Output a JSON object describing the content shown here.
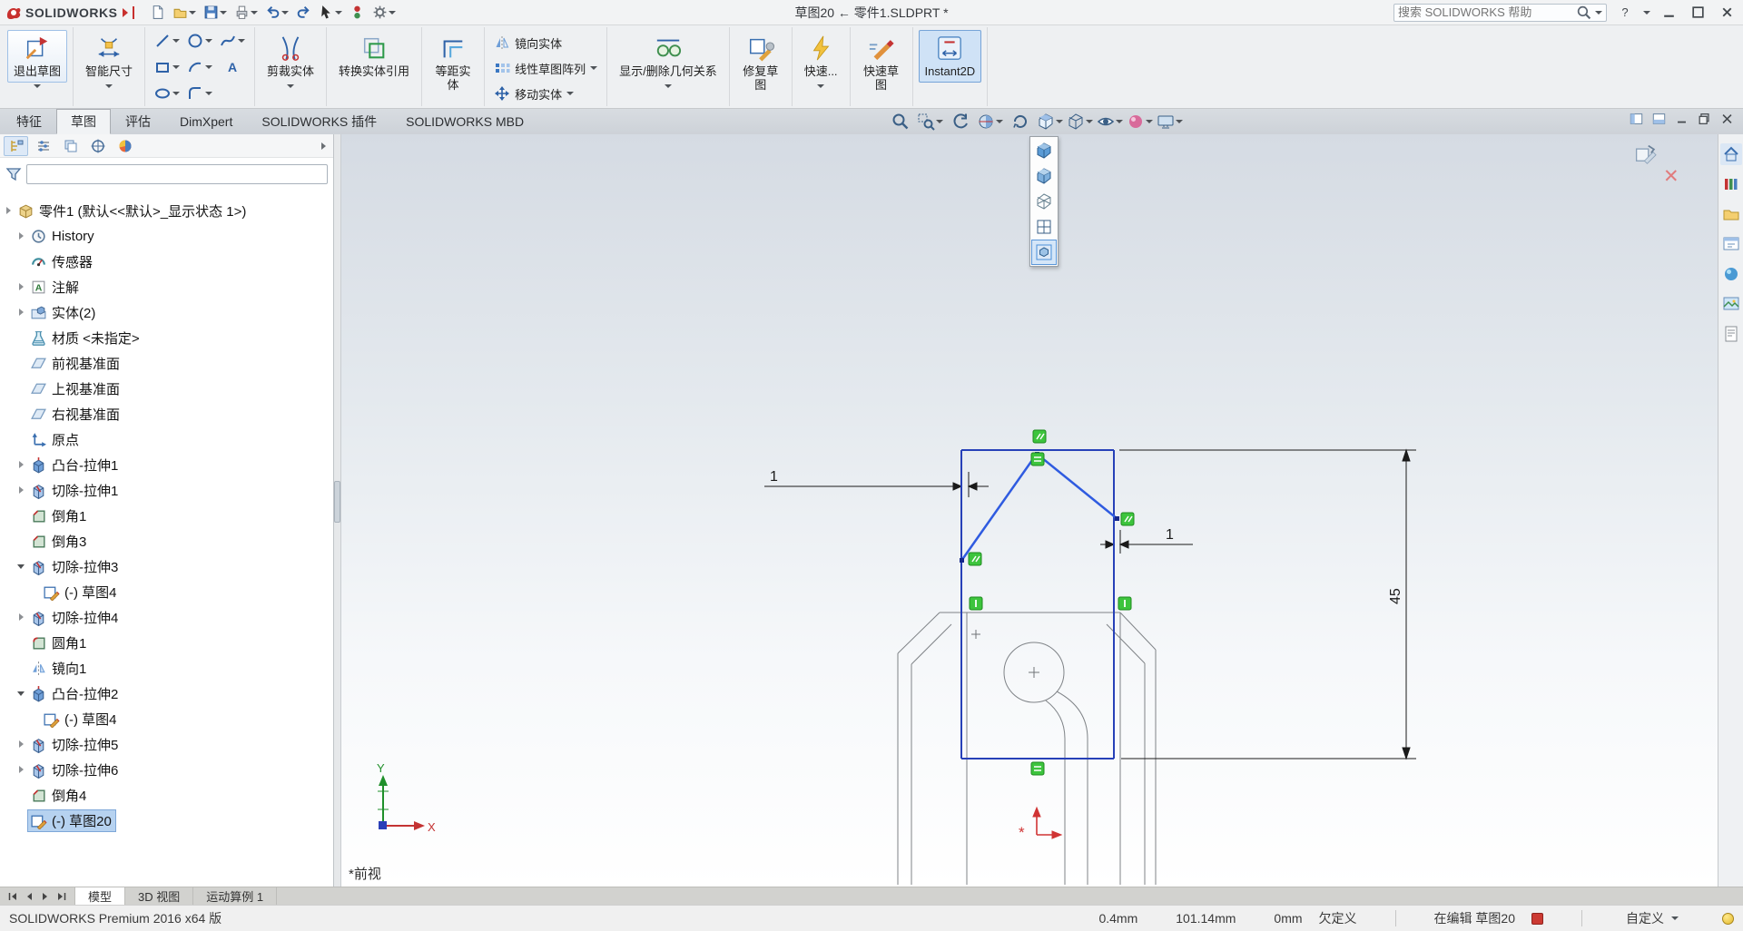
{
  "titlebar": {
    "logo": "SOLIDWORKS",
    "title": "草图20 ← 零件1.SLDPRT *",
    "search_placeholder": "搜索 SOLIDWORKS 帮助",
    "help": "?",
    "quick_icons": [
      "new-file-icon",
      "open-icon",
      "save-icon",
      "print-icon",
      "undo-icon",
      "redo-icon",
      "select-cursor-icon",
      "rebuild-icon",
      "options-gear-icon"
    ]
  },
  "ribbon": {
    "exit_sketch": "退出草图",
    "smart_dimension": "智能尺寸",
    "trim_entities": "剪裁实体",
    "convert_entities": "转换实体引用",
    "offset_entities": "等距实体",
    "mirror_entities": "镜向实体",
    "linear_pattern": "线性草图阵列",
    "move_entities": "移动实体",
    "display_delete_relations": "显示/删除几何关系",
    "repair_sketch": "修复草图",
    "quick_snaps": "快速...",
    "rapid_sketch": "快速草图",
    "instant2d": "Instant2D"
  },
  "command_tabs": [
    {
      "label": "特征",
      "active": false
    },
    {
      "label": "草图",
      "active": true
    },
    {
      "label": "评估",
      "active": false
    },
    {
      "label": "DimXpert",
      "active": false
    },
    {
      "label": "SOLIDWORKS 插件",
      "active": false
    },
    {
      "label": "SOLIDWORKS MBD",
      "active": false
    }
  ],
  "headsup_icons": [
    "zoom-fit-icon",
    "zoom-area-icon",
    "previous-view-icon",
    "section-view-icon",
    "rotate-view-icon",
    "view-orientation-cube-icon",
    "display-style-icon",
    "hide-show-items-icon",
    "edit-appearance-icon",
    "view-settings-icon"
  ],
  "view_selector": {
    "items": [
      "iso-cube-icon",
      "dimetric-cube-icon",
      "wireframe-cube-icon",
      "four-view-icon",
      "view-selector-icon"
    ],
    "active_index": 4
  },
  "window_doc_controls": [
    "pane-left-icon",
    "pane-bottom-icon",
    "minimize-icon",
    "restore-icon",
    "close-icon"
  ],
  "panel_tabs": [
    "fm-tab-icon",
    "pm-tab-icon",
    "cfg-tab-icon",
    "dx-tab-icon",
    "dm-tab-icon"
  ],
  "feature_tree": {
    "root": {
      "label": "零件1 (默认<<默认>_显示状态 1>)",
      "icon": "part-icon",
      "arrow": "collapsed"
    },
    "items": [
      {
        "label": "History",
        "icon": "history-icon",
        "arrow": "collapsed",
        "level": 1
      },
      {
        "label": "传感器",
        "icon": "sensors-icon",
        "arrow": "none",
        "level": 1
      },
      {
        "label": "注解",
        "icon": "annotations-icon",
        "arrow": "collapsed",
        "level": 1
      },
      {
        "label": "实体(2)",
        "icon": "solid-bodies-icon",
        "arrow": "collapsed",
        "level": 1
      },
      {
        "label": "材质 <未指定>",
        "icon": "material-icon",
        "arrow": "none",
        "level": 1
      },
      {
        "label": "前视基准面",
        "icon": "plane-icon",
        "arrow": "none",
        "level": 1
      },
      {
        "label": "上视基准面",
        "icon": "plane-icon",
        "arrow": "none",
        "level": 1
      },
      {
        "label": "右视基准面",
        "icon": "plane-icon",
        "arrow": "none",
        "level": 1
      },
      {
        "label": "原点",
        "icon": "origin-icon",
        "arrow": "none",
        "level": 1
      },
      {
        "label": "凸台-拉伸1",
        "icon": "boss-extrude-icon",
        "arrow": "collapsed",
        "level": 1
      },
      {
        "label": "切除-拉伸1",
        "icon": "cut-extrude-icon",
        "arrow": "collapsed",
        "level": 1
      },
      {
        "label": "倒角1",
        "icon": "chamfer-icon",
        "arrow": "none",
        "level": 1
      },
      {
        "label": "倒角3",
        "icon": "chamfer-icon",
        "arrow": "none",
        "level": 1
      },
      {
        "label": "切除-拉伸3",
        "icon": "cut-extrude-icon",
        "arrow": "expanded",
        "level": 1
      },
      {
        "label": "(-) 草图4",
        "icon": "sketch-icon",
        "arrow": "none",
        "level": 2
      },
      {
        "label": "切除-拉伸4",
        "icon": "cut-extrude-icon",
        "arrow": "collapsed",
        "level": 1
      },
      {
        "label": "圆角1",
        "icon": "fillet-icon",
        "arrow": "none",
        "level": 1
      },
      {
        "label": "镜向1",
        "icon": "mirror-feature-icon",
        "arrow": "none",
        "level": 1
      },
      {
        "label": "凸台-拉伸2",
        "icon": "boss-extrude-icon",
        "arrow": "expanded",
        "level": 1
      },
      {
        "label": "(-) 草图4",
        "icon": "sketch-icon",
        "arrow": "none",
        "level": 2
      },
      {
        "label": "切除-拉伸5",
        "icon": "cut-extrude-icon",
        "arrow": "collapsed",
        "level": 1
      },
      {
        "label": "切除-拉伸6",
        "icon": "cut-extrude-icon",
        "arrow": "collapsed",
        "level": 1
      },
      {
        "label": "倒角4",
        "icon": "chamfer-icon",
        "arrow": "none",
        "level": 1
      },
      {
        "label": "(-) 草图20",
        "icon": "sketch-icon",
        "arrow": "none",
        "level": 1,
        "selected": true
      }
    ]
  },
  "graphics": {
    "view_label": "*前视",
    "dimensions": {
      "left_gap": "1",
      "right_gap": "1",
      "height": "45"
    },
    "triad": {
      "x": "X",
      "y": "Y"
    }
  },
  "task_pane_icons": [
    "resources-home-icon",
    "design-library-icon",
    "file-explorer-icon",
    "view-palette-icon",
    "appearances-icon",
    "scenes-icon",
    "custom-properties-icon"
  ],
  "bottom_tabs": [
    {
      "label": "模型",
      "active": true
    },
    {
      "label": "3D 视图",
      "active": false
    },
    {
      "label": "运动算例 1",
      "active": false
    }
  ],
  "statusbar": {
    "app_version": "SOLIDWORKS Premium 2016 x64 版",
    "m1": "0.4mm",
    "m2": "101.14mm",
    "m3": "0mm",
    "define_state": "欠定义",
    "editing": "在编辑 草图20",
    "custom": "自定义"
  }
}
